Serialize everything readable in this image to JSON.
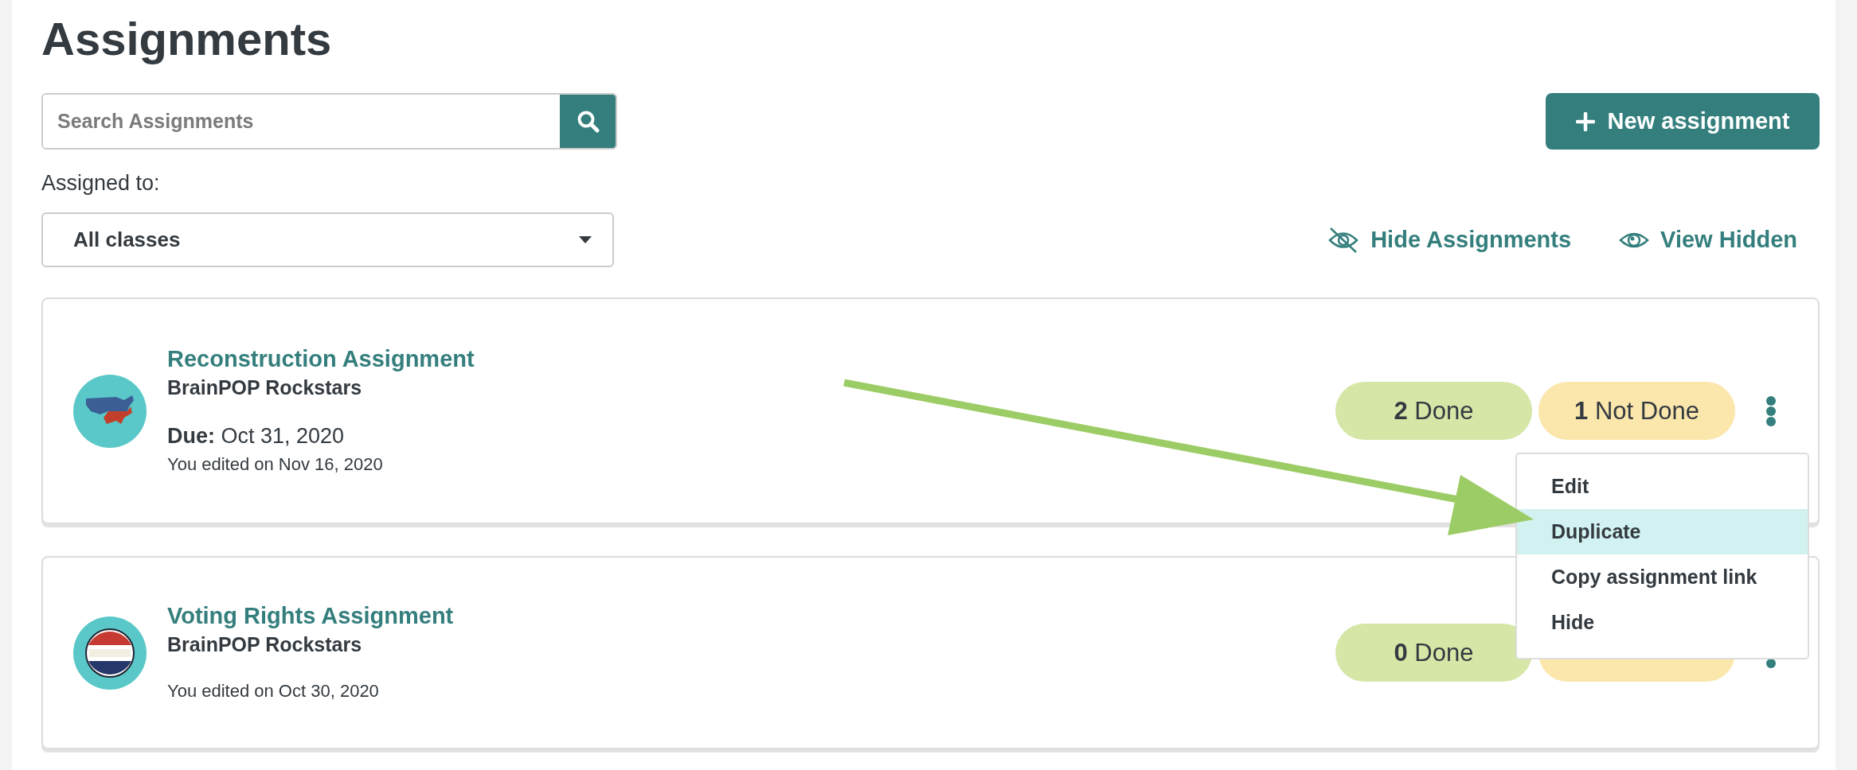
{
  "title": "Assignments",
  "search": {
    "placeholder": "Search Assignments"
  },
  "new_button": {
    "label": "New assignment"
  },
  "filter": {
    "label": "Assigned to:",
    "value": "All classes"
  },
  "links": [
    {
      "kind": "hide",
      "label": "Hide Assignments"
    },
    {
      "kind": "view",
      "label": "View Hidden"
    }
  ],
  "assignments": [
    {
      "title": "Reconstruction Assignment",
      "avatar": {
        "kind": "map"
      },
      "class": "BrainPOP Rockstars",
      "due": "**Due:** Oct 31, 2020",
      "edited": "You edited on Nov 16, 2020",
      "stats": [
        {
          "kind": "done",
          "count": "2",
          "label": "Done"
        },
        {
          "kind": "not_done",
          "count": "1",
          "label": "Not Done"
        }
      ]
    },
    {
      "title": "Voting Rights Assignment",
      "avatar": {
        "kind": "badge"
      },
      "class": "BrainPOP Rockstars",
      "edited": "You edited on Oct 30, 2020",
      "stats": [
        {
          "kind": "done",
          "count": "0",
          "label": "Done"
        },
        {
          "kind": "not_done"
        }
      ]
    }
  ],
  "menu": {
    "items": [
      {
        "label": "Edit",
        "selected": false
      },
      {
        "label": "Duplicate",
        "selected": true
      },
      {
        "label": "Copy assignment link",
        "selected": false
      },
      {
        "label": "Hide",
        "selected": false
      }
    ]
  }
}
